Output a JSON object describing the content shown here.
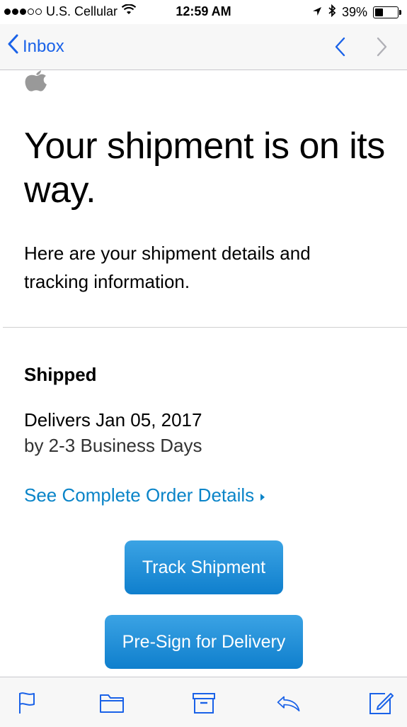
{
  "status_bar": {
    "carrier": "U.S. Cellular",
    "time": "12:59 AM",
    "battery_percent": "39%",
    "battery_level": 0.39,
    "signal_bars_filled": 3,
    "signal_bars_total": 5
  },
  "nav": {
    "back_label": "Inbox",
    "accent_color": "#1a62e8"
  },
  "email": {
    "headline": "Your shipment is on its way.",
    "subtext": "Here are your shipment details and tracking information.",
    "status_title": "Shipped",
    "delivers": "Delivers Jan 05, 2017",
    "delivery_window": "by 2-3 Business Days",
    "order_link": "See Complete Order Details",
    "track_button": "Track Shipment",
    "presign_button": "Pre-Sign for Delivery",
    "link_color": "#0a84c8"
  },
  "toolbar": {
    "icons": [
      "flag-icon",
      "folder-icon",
      "archive-icon",
      "reply-icon",
      "compose-icon"
    ]
  }
}
